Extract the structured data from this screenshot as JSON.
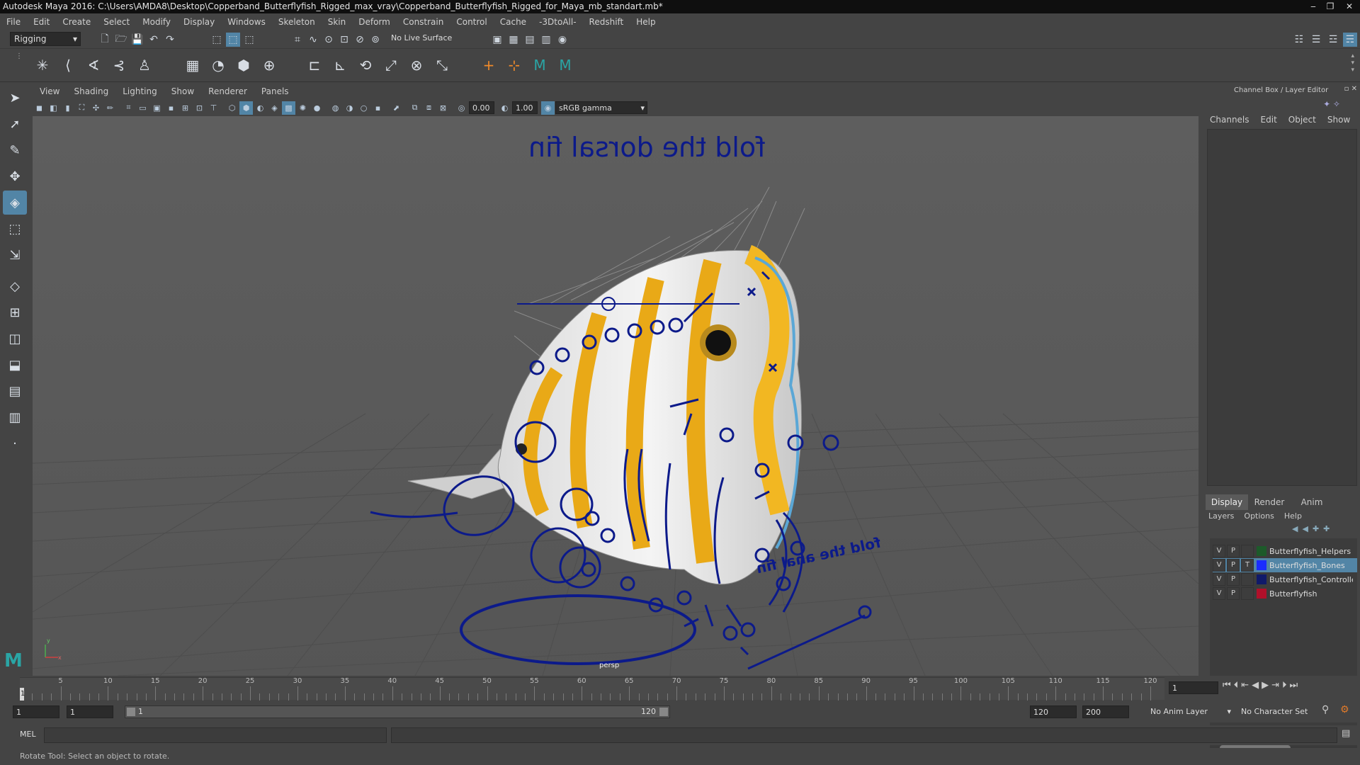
{
  "window": {
    "title": "Autodesk Maya 2016: C:\\Users\\AMDA8\\Desktop\\Copperband_Butterflyfish_Rigged_max_vray\\Copperband_Butterflyfish_Rigged_for_Maya_mb_standart.mb*",
    "minimize": "‒",
    "maximize": "❐",
    "close": "✕"
  },
  "menubar": [
    "File",
    "Edit",
    "Create",
    "Select",
    "Modify",
    "Display",
    "Windows",
    "Skeleton",
    "Skin",
    "Deform",
    "Constrain",
    "Control",
    "Cache",
    "-3DtoAll-",
    "Redshift",
    "Help"
  ],
  "statusline": {
    "menuset": "Rigging",
    "live_surface": "No Live Surface"
  },
  "panel": {
    "menus": [
      "View",
      "Shading",
      "Lighting",
      "Show",
      "Renderer",
      "Panels"
    ],
    "exposure": "0.00",
    "gamma": "1.00",
    "colorspace": "sRGB gamma"
  },
  "viewport": {
    "camera": "persp",
    "label_dorsal": "fold the dorsal fin",
    "label_anal": "fold the anal fin",
    "axis_y": "y",
    "axis_x": "x"
  },
  "channelbox": {
    "title": "Channel Box / Layer Editor",
    "menus": [
      "Channels",
      "Edit",
      "Object",
      "Show"
    ],
    "tabs": [
      "Display",
      "Render",
      "Anim"
    ],
    "layer_menus": [
      "Layers",
      "Options",
      "Help"
    ],
    "layers": [
      {
        "v": "V",
        "p": "P",
        "t": "",
        "name": "Butterflyfish_Helpers",
        "color": "#1d5a2a",
        "selected": false
      },
      {
        "v": "V",
        "p": "P",
        "t": "T",
        "name": "Butterflyfish_Bones",
        "color": "#1a2cff",
        "selected": true
      },
      {
        "v": "V",
        "p": "P",
        "t": "",
        "name": "Butterflyfish_Controllers",
        "color": "#101a6a",
        "selected": false
      },
      {
        "v": "V",
        "p": "P",
        "t": "",
        "name": "Butterflyfish",
        "color": "#b0102a",
        "selected": false
      }
    ]
  },
  "timeline": {
    "ticks": [
      "5",
      "10",
      "15",
      "20",
      "25",
      "30",
      "35",
      "40",
      "45",
      "50",
      "55",
      "60",
      "65",
      "70",
      "75",
      "80",
      "85",
      "90",
      "95",
      "100",
      "105",
      "110",
      "115",
      "120"
    ],
    "current_marker": "1",
    "current_frame": "1"
  },
  "range": {
    "start": "1",
    "inner_start": "1",
    "slider_start": "1",
    "slider_end": "120",
    "end": "120",
    "outer_end": "200",
    "anim_layer": "No Anim Layer",
    "character_set": "No Character Set"
  },
  "cmdline": {
    "label": "MEL"
  },
  "helpline": "Rotate Tool: Select an object to rotate."
}
